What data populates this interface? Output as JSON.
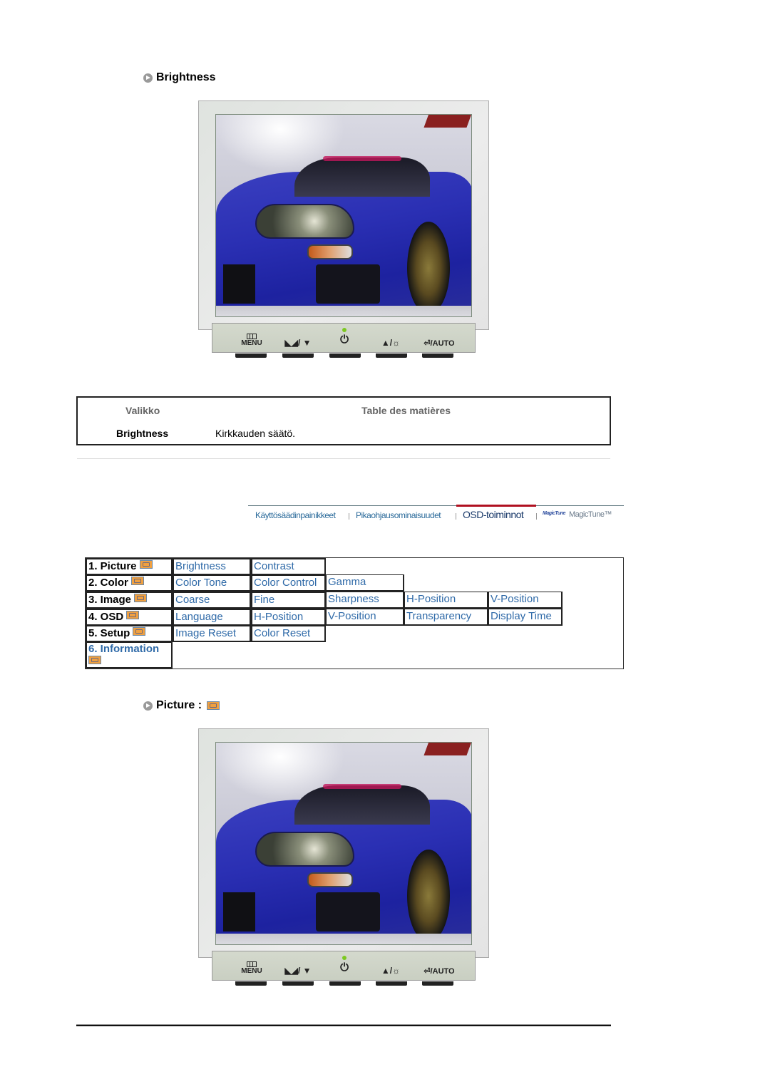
{
  "section1": {
    "title": "Brightness",
    "icon": "arrow-circle-icon"
  },
  "monitor_panel": {
    "menu_label": "MENU",
    "adjust_label": "/ ▼",
    "power_symbol": "⏻",
    "bright_label": "▲/☼",
    "auto_label": "/AUTO",
    "led_color": "#7cc820"
  },
  "description_table": {
    "header_menu": "Valikko",
    "header_contents": "Table des matières",
    "row_label": "Brightness",
    "row_text": "Kirkkauden säätö."
  },
  "nav": {
    "items": [
      {
        "label": "Käyttösäädinpainikkeet",
        "active": false
      },
      {
        "label": "Pikaohjausominaisuudet",
        "active": false
      },
      {
        "label": "OSD-toiminnot",
        "active": true
      },
      {
        "label": "MagicTune™",
        "active": false
      }
    ],
    "logo_text": "MagicTune",
    "active_color": "#b01020",
    "link_color": "#2a6a9a"
  },
  "osd_menu": {
    "rows": [
      {
        "head": "1. Picture",
        "icon": "picture-icon",
        "items": [
          "Brightness",
          "Contrast"
        ]
      },
      {
        "head": "2. Color",
        "icon": "color-icon",
        "items": [
          "Color Tone",
          "Color Control",
          "Gamma"
        ]
      },
      {
        "head": "3. Image",
        "icon": "image-icon",
        "items": [
          "Coarse",
          "Fine",
          "Sharpness",
          "H-Position",
          "V-Position"
        ]
      },
      {
        "head": "4. OSD",
        "icon": "osd-icon",
        "items": [
          "Language",
          "H-Position",
          "V-Position",
          "Transparency",
          "Display Time"
        ]
      },
      {
        "head": "5. Setup",
        "icon": "setup-icon",
        "items": [
          "Image Reset",
          "Color Reset"
        ]
      },
      {
        "head": "6. Information",
        "icon": "information-icon",
        "items": []
      }
    ],
    "link_color": "#2f6aa8"
  },
  "section2": {
    "title": "Picture :",
    "icon": "arrow-circle-icon"
  }
}
